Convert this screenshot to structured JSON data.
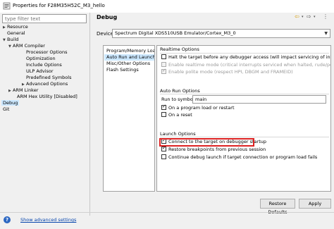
{
  "window": {
    "title": "Properties for F28M35H52C_M3_hello"
  },
  "sidebar": {
    "filter_placeholder": "type filter text",
    "items": [
      {
        "label": "Resource",
        "expander": "collapsed"
      },
      {
        "label": "General",
        "expander": "none"
      },
      {
        "label": "Build",
        "expander": "expanded"
      },
      {
        "label": "ARM Compiler",
        "expander": "expanded"
      },
      {
        "label": "Processor Options",
        "expander": "none"
      },
      {
        "label": "Optimization",
        "expander": "none"
      },
      {
        "label": "Include Options",
        "expander": "none"
      },
      {
        "label": "ULP Advisor",
        "expander": "none"
      },
      {
        "label": "Predefined Symbols",
        "expander": "none"
      },
      {
        "label": "Advanced Options",
        "expander": "collapsed"
      },
      {
        "label": "ARM Linker",
        "expander": "collapsed"
      },
      {
        "label": "ARM Hex Utility  [Disabled]",
        "expander": "none"
      },
      {
        "label": "Debug",
        "expander": "none",
        "selected": true
      },
      {
        "label": "Git",
        "expander": "none"
      }
    ]
  },
  "header": {
    "page_title": "Debug",
    "icons": [
      "back-arrow-icon",
      "dropdown-icon",
      "forward-arrow-icon",
      "dropdown-icon",
      "menu-icon"
    ]
  },
  "device": {
    "label": "Device",
    "value": "Spectrum Digital XDS510USB Emulator/Cortex_M3_0"
  },
  "config_list": [
    "Program/Memory Load",
    "Auto Run and Launch Op",
    "Misc/Other Options",
    "Flash Settings"
  ],
  "config_selected": 1,
  "realtime": {
    "title": "Realtime Options",
    "options": [
      {
        "label": "Halt the target before any debugger access (will impact servicing of interrupts",
        "checked": false,
        "disabled": false
      },
      {
        "label": "Enable realtime mode (critical interrupts serviced when halted, rude/polite m",
        "checked": false,
        "disabled": true
      },
      {
        "label": "Enable polite mode (respect HPI, DBGM and FRAMEID)",
        "checked": true,
        "disabled": true
      }
    ]
  },
  "auto_run": {
    "title": "Auto Run Options",
    "run_label": "Run to symbol",
    "run_value": "main",
    "options": [
      {
        "label": "On a program load or restart",
        "checked": true
      },
      {
        "label": "On a reset",
        "checked": false
      }
    ]
  },
  "launch": {
    "title": "Launch Options",
    "options": [
      {
        "label": "Connect to the target on debugger startup",
        "checked": true
      },
      {
        "label": "Restore breakpoints from previous session",
        "checked": true
      },
      {
        "label": "Continue debug launch if target connection or program load fails",
        "checked": false
      }
    ]
  },
  "buttons": {
    "restore": "Restore Defaults",
    "apply": "Apply"
  },
  "footer": {
    "advanced_link": "Show advanced settings"
  },
  "colors": {
    "selection": "#cce8ff",
    "highlight_box": "#dd2222",
    "link": "#0645ad"
  }
}
